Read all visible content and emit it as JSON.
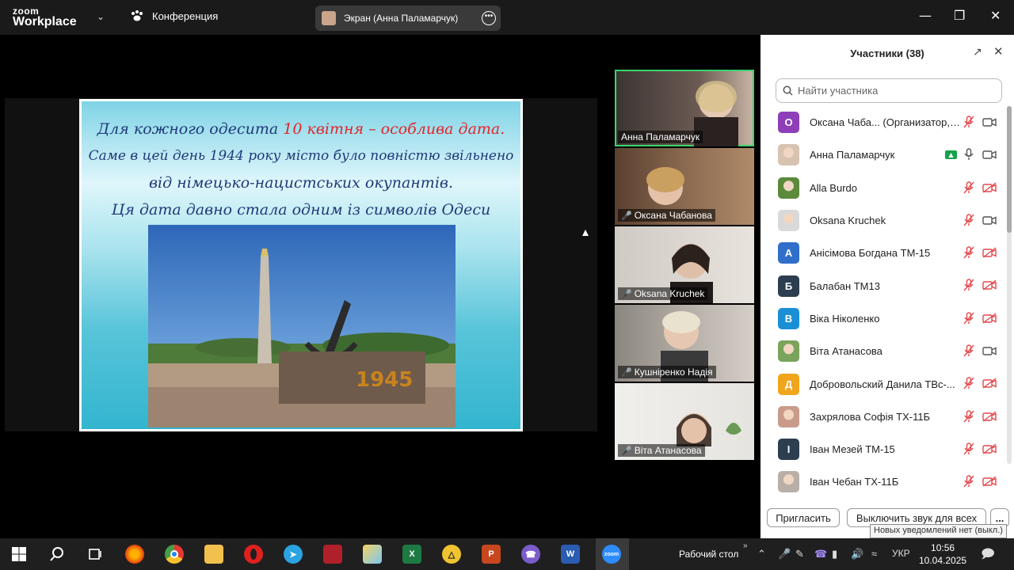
{
  "titlebar": {
    "logo_line1": "zoom",
    "logo_line2": "Workplace",
    "conference_label": "Конференция",
    "screen_share_label": "Экран (Анна Паламарчук)"
  },
  "slide": {
    "line1_a": "Для кожного одесита ",
    "line1_b": "10 квітня – особлива дата.",
    "line2": "Саме в цей день 1944 року місто було повністю звільнено",
    "line3": "від німецько-нацистських окупантів.",
    "line4": "Ця дата давно стала одним із символів Одеси",
    "monument_plaque": "1945"
  },
  "gallery": [
    {
      "name": "Анна Паламарчук",
      "muted": false,
      "active": true
    },
    {
      "name": "Оксана Чабанова",
      "muted": true,
      "active": false
    },
    {
      "name": "Oksana Kruchek",
      "muted": true,
      "active": false
    },
    {
      "name": "Кушніренко Надія",
      "muted": true,
      "active": false
    },
    {
      "name": "Віта Атанасова",
      "muted": true,
      "active": false
    }
  ],
  "panel": {
    "title": "Участники (38)",
    "search_placeholder": "Найти участника",
    "participants": [
      {
        "name": "Оксана Чаба... (Организатор, я)",
        "initial": "О",
        "color": "#8e3fb8",
        "mic": "muted",
        "cam": "on",
        "photo": false
      },
      {
        "name": "Анна Паламарчук",
        "initial": "",
        "color": "#d8c2b0",
        "mic": "on",
        "cam": "on",
        "photo": true,
        "sharing": true
      },
      {
        "name": "Alla Burdo",
        "initial": "",
        "color": "#5b8a3a",
        "mic": "muted",
        "cam": "off",
        "photo": true
      },
      {
        "name": "Oksana Kruchek",
        "initial": "",
        "color": "#d9d9d9",
        "mic": "muted",
        "cam": "on",
        "photo": true
      },
      {
        "name": "Анісімова Богдана ТМ-15",
        "initial": "А",
        "color": "#2f6fc9",
        "mic": "muted",
        "cam": "off",
        "photo": false
      },
      {
        "name": "Балабан ТМ13",
        "initial": "Б",
        "color": "#2c3e50",
        "mic": "muted",
        "cam": "off",
        "photo": false
      },
      {
        "name": "Віка Ніколенко",
        "initial": "В",
        "color": "#1a8fd6",
        "mic": "muted",
        "cam": "off",
        "photo": false
      },
      {
        "name": "Віта Атанасова",
        "initial": "",
        "color": "#7aa35c",
        "mic": "muted",
        "cam": "on",
        "photo": true
      },
      {
        "name": "Добровольский Данила ТВс-...",
        "initial": "Д",
        "color": "#f0a51c",
        "mic": "muted",
        "cam": "off",
        "photo": false
      },
      {
        "name": "Захрялова Софія ТХ-11Б",
        "initial": "",
        "color": "#c99b8a",
        "mic": "muted",
        "cam": "off",
        "photo": true
      },
      {
        "name": "Іван Мезей ТМ-15",
        "initial": "І",
        "color": "#2c3e50",
        "mic": "muted",
        "cam": "off",
        "photo": false
      },
      {
        "name": "Іван Чебан ТХ-11Б",
        "initial": "",
        "color": "#b8b0a8",
        "mic": "muted",
        "cam": "off",
        "photo": true
      }
    ],
    "invite_button": "Пригласить",
    "mute_all_button": "Выключить звук для всех",
    "more_button": "...",
    "tooltip": "Новых уведомлений нет (выкл.)"
  },
  "taskbar": {
    "desktop_label": "Рабочий стол",
    "language": "УКР",
    "time": "10:56",
    "date": "10.04.2025",
    "zoom_label": "zoom",
    "word_label": "W",
    "excel_label": "X",
    "ppt_label": "P"
  },
  "colors": {
    "active_speaker": "#3ed26d",
    "mute_red": "#e5484d",
    "taskbar": "#1f1f1f"
  }
}
